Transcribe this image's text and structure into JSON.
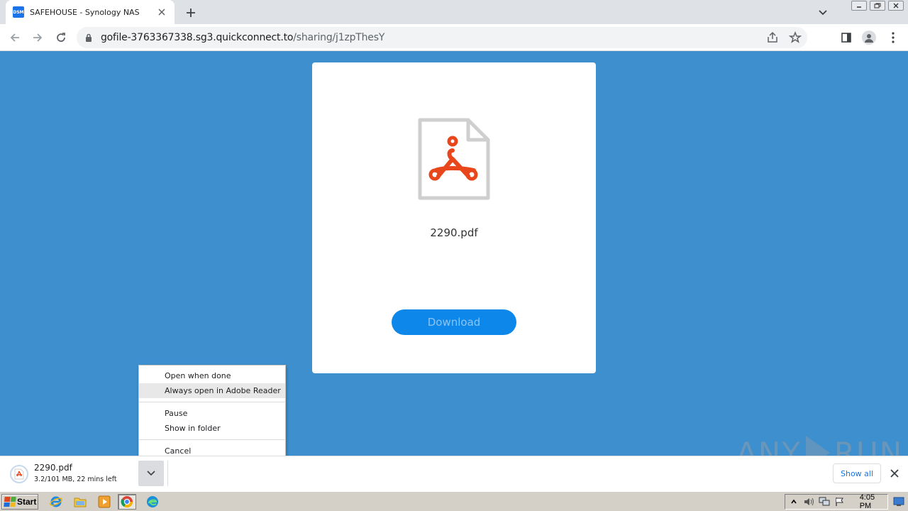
{
  "browser": {
    "tab": {
      "favicon_text": "DSM",
      "title": "SAFEHOUSE - Synology NAS"
    },
    "url": {
      "host": "gofile-3763367338.sg3.quickconnect.to",
      "path": "/sharing/j1zpThesY"
    }
  },
  "page": {
    "filename": "2290.pdf",
    "download_label": "Download",
    "accent_color": "#0d88ea",
    "background_color": "#3d8fce"
  },
  "context_menu": {
    "items": [
      {
        "label": "Open when done"
      },
      {
        "label": "Always open in Adobe Reader"
      },
      {
        "label": "Pause"
      },
      {
        "label": "Show in folder"
      },
      {
        "label": "Cancel"
      }
    ]
  },
  "download_shelf": {
    "item": {
      "name": "2290.pdf",
      "status": "3.2/101 MB, 22 mins left"
    },
    "show_all_label": "Show all"
  },
  "watermark": {
    "left": "ANY",
    "right": "RUN"
  },
  "taskbar": {
    "start_label": "Start",
    "apps": [
      "internet-explorer-icon",
      "file-explorer-icon",
      "media-player-icon",
      "chrome-icon",
      "edge-icon"
    ],
    "clock": "4:05 PM"
  }
}
